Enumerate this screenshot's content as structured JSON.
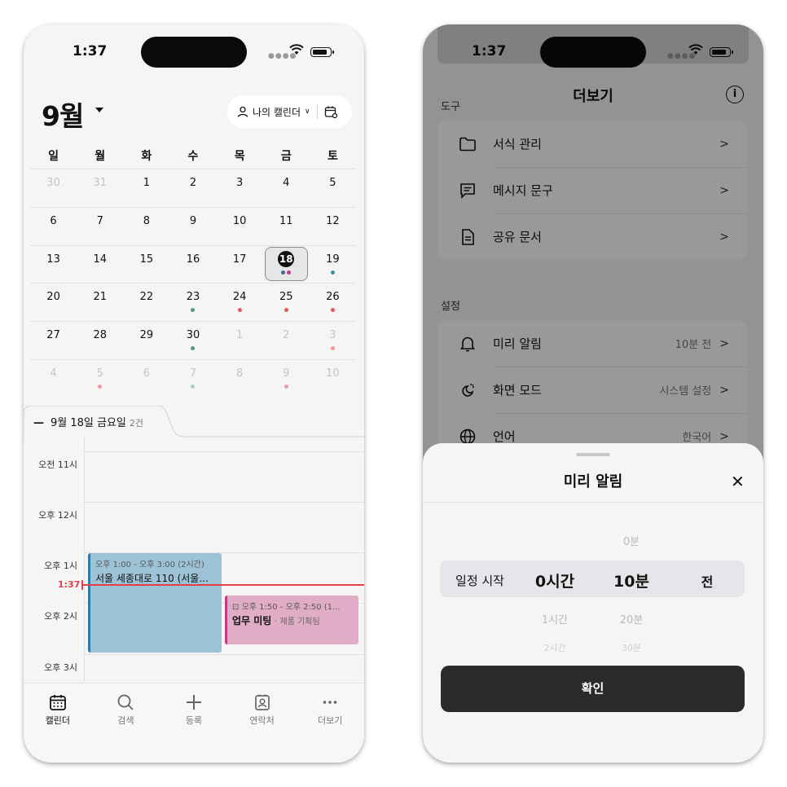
{
  "left": {
    "status_time": "1:37",
    "month_title": "9월",
    "calendar_selector": "나의 캘린더",
    "weekdays": [
      "일",
      "월",
      "화",
      "수",
      "목",
      "금",
      "토"
    ],
    "weeks": [
      [
        "30",
        "31",
        "1",
        "2",
        "3",
        "4",
        "5"
      ],
      [
        "6",
        "7",
        "8",
        "9",
        "10",
        "11",
        "12"
      ],
      [
        "13",
        "14",
        "15",
        "16",
        "17",
        "18",
        "19"
      ],
      [
        "20",
        "21",
        "22",
        "23",
        "24",
        "25",
        "26"
      ],
      [
        "27",
        "28",
        "29",
        "30",
        "1",
        "2",
        "3"
      ],
      [
        "4",
        "5",
        "6",
        "7",
        "8",
        "9",
        "10"
      ]
    ],
    "colors": {
      "teal": "#3f8fa6",
      "green": "#5a9a7a",
      "red": "#e35a5a",
      "pink": "#f09aa0",
      "today_dot_a": "#2f6fa0",
      "today_dot_b": "#c43b7f",
      "now": "#e0404a"
    },
    "day_header": "9월 18일 금요일",
    "day_count": "2건",
    "time_labels": [
      "오전 11시",
      "오후 12시",
      "오후 1시",
      "오후 2시",
      "오후 3시"
    ],
    "now_label": "1:37",
    "event1": {
      "time": "오후 1:00 - 오후 3:00 (2시간)",
      "title": "서울 세종대로 110 (서울..."
    },
    "event2": {
      "time": "오후 1:50 - 오후 2:50 (1...",
      "title": "업무 미팅",
      "subtitle": "· 제품 기획팀"
    },
    "tabs": [
      "캘린더",
      "검색",
      "등록",
      "연락처",
      "더보기"
    ]
  },
  "right": {
    "status_time": "1:37",
    "title": "더보기",
    "section_tools": "도구",
    "tools": [
      "서식 관리",
      "메시지 문구",
      "공유 문서"
    ],
    "section_settings": "설정",
    "settings": [
      {
        "label": "미리 알림",
        "value": "10분 전"
      },
      {
        "label": "화면 모드",
        "value": "시스템 설정"
      },
      {
        "label": "언어",
        "value": "한국어"
      }
    ],
    "sheet_title": "미리 알림",
    "picker": {
      "label": "일정 시작",
      "hours": {
        "above": "",
        "selected": "0시간",
        "below": "1시간",
        "below2": "2시간"
      },
      "minutes": {
        "above": "0분",
        "selected": "10분",
        "below": "20분",
        "below2": "30분"
      },
      "suffix": "전"
    },
    "confirm": "확인"
  }
}
